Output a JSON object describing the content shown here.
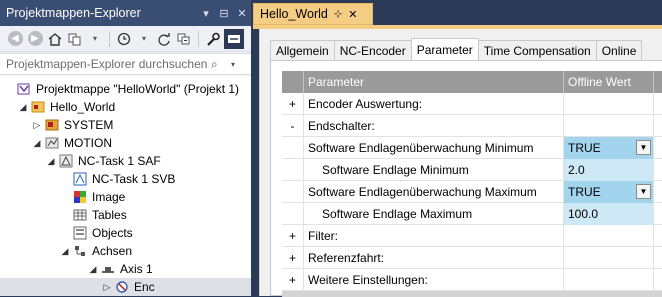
{
  "explorer": {
    "title": "Projektmappen-Explorer",
    "title_buttons": [
      "▾",
      "⊟",
      "✕"
    ],
    "search_placeholder": "Projektmappen-Explorer durchsuchen",
    "search_icon": "⌕",
    "tree": [
      {
        "label": "Projektmappe \"HelloWorld\" (Projekt 1)",
        "icon": "solution-icon"
      },
      {
        "label": "Hello_World",
        "icon": "project-icon"
      },
      {
        "label": "SYSTEM",
        "icon": "system-icon"
      },
      {
        "label": "MOTION",
        "icon": "motion-icon"
      },
      {
        "label": "NC-Task 1 SAF",
        "icon": "nc-task-icon"
      },
      {
        "label": "NC-Task 1 SVB",
        "icon": "nc-svb-icon"
      },
      {
        "label": "Image",
        "icon": "image-icon"
      },
      {
        "label": "Tables",
        "icon": "table-icon"
      },
      {
        "label": "Objects",
        "icon": "objects-icon"
      },
      {
        "label": "Achsen",
        "icon": "axes-icon"
      },
      {
        "label": "Axis 1",
        "icon": "axis-icon"
      },
      {
        "label": "Enc",
        "icon": "encoder-icon"
      }
    ]
  },
  "doc": {
    "tab_title": "Hello_World",
    "pin": "⊹",
    "close": "✕",
    "tabs": [
      "Allgemein",
      "NC-Encoder",
      "Parameter",
      "Time Compensation",
      "Online"
    ],
    "grid": {
      "col_parameter": "Parameter",
      "col_offline": "Offline Wert",
      "rows": [
        {
          "exp": "+",
          "name": "Encoder Auswertung:",
          "value": ""
        },
        {
          "exp": "-",
          "name": "Endschalter:",
          "value": ""
        },
        {
          "exp": "",
          "name": "Software Endlagenüberwachung Minimum",
          "value": "TRUE"
        },
        {
          "exp": "",
          "name": "Software Endlage Minimum",
          "value": "2.0"
        },
        {
          "exp": "",
          "name": "Software Endlagenüberwachung Maximum",
          "value": "TRUE"
        },
        {
          "exp": "",
          "name": "Software Endlage Maximum",
          "value": "100.0"
        },
        {
          "exp": "+",
          "name": "Filter:",
          "value": ""
        },
        {
          "exp": "+",
          "name": "Referenzfahrt:",
          "value": ""
        },
        {
          "exp": "+",
          "name": "Weitere Einstellungen:",
          "value": ""
        }
      ]
    }
  }
}
